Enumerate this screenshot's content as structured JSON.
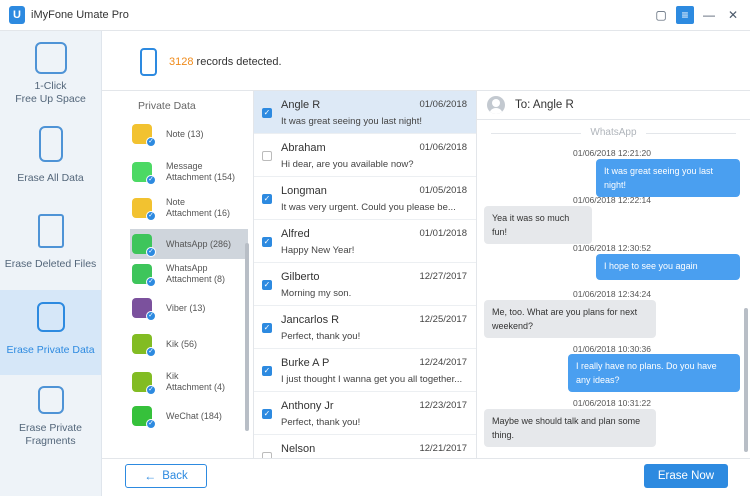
{
  "window": {
    "logo": "U",
    "title": "iMyFone Umate Pro",
    "controls": {
      "feedback_icon": "▢",
      "menu_icon": "≡",
      "minimize_icon": "—",
      "close_icon": "✕"
    }
  },
  "sidebar": {
    "items": [
      {
        "label": "1-Click\nFree Up Space",
        "icon": "broom-phone-icon",
        "active": false
      },
      {
        "label": "Erase All Data",
        "icon": "phone-erase-icon",
        "active": false
      },
      {
        "label": "Erase Deleted Files",
        "icon": "trash-icon",
        "active": false
      },
      {
        "label": "Erase Private Data",
        "icon": "lock-file-icon",
        "active": true
      },
      {
        "label": "Erase Private\nFragments",
        "icon": "app-fragment-icon",
        "active": false
      }
    ]
  },
  "header": {
    "count": "3128",
    "text": " records detected."
  },
  "private_data": {
    "title": "Private Data",
    "items": [
      {
        "label": "Note (13)",
        "icon": "note-icon",
        "color": "#f2c230"
      },
      {
        "label": "Message\nAttachment (154)",
        "icon": "message-icon",
        "color": "#4cd964"
      },
      {
        "label": "Note\nAttachment (16)",
        "icon": "note-icon",
        "color": "#f2c230"
      },
      {
        "label": "WhatsApp (286)",
        "icon": "whatsapp-icon",
        "color": "#3ec55b"
      },
      {
        "label": "WhatsApp\nAttachment (8)",
        "icon": "whatsapp-icon",
        "color": "#3ec55b"
      },
      {
        "label": "Viber (13)",
        "icon": "viber-icon",
        "color": "#7b519d"
      },
      {
        "label": "Kik (56)",
        "icon": "kik-icon",
        "color": "#82bc23"
      },
      {
        "label": "Kik\nAttachment (4)",
        "icon": "kik-icon",
        "color": "#82bc23"
      },
      {
        "label": "WeChat (184)",
        "icon": "wechat-icon",
        "color": "#36c13b"
      }
    ]
  },
  "contacts": [
    {
      "name": "Angle R",
      "date": "01/06/2018",
      "msg": "It was great seeing you last night!",
      "checked": true
    },
    {
      "name": "Abraham",
      "date": "01/06/2018",
      "msg": "Hi dear, are you available now?",
      "checked": false
    },
    {
      "name": "Longman",
      "date": "01/05/2018",
      "msg": "It was very urgent. Could you please be...",
      "checked": true
    },
    {
      "name": "Alfred",
      "date": "01/01/2018",
      "msg": "Happy New Year!",
      "checked": true
    },
    {
      "name": "Gilberto",
      "date": "12/27/2017",
      "msg": "Morning my son.",
      "checked": true
    },
    {
      "name": "Jancarlos R",
      "date": "12/25/2017",
      "msg": "Perfect, thank you!",
      "checked": true
    },
    {
      "name": "Burke A P",
      "date": "12/24/2017",
      "msg": "I just thought I wanna get you all together...",
      "checked": true
    },
    {
      "name": "Anthony Jr",
      "date": "12/23/2017",
      "msg": "Perfect, thank you!",
      "checked": true
    },
    {
      "name": "Nelson",
      "date": "12/21/2017",
      "msg": "",
      "checked": false
    }
  ],
  "chat": {
    "to_label": "To: Angle R",
    "app_label": "WhatsApp",
    "messages": [
      {
        "time": "01/06/2018 12:21:20",
        "text": "It was great seeing you last night!",
        "dir": "out"
      },
      {
        "time": "01/06/2018 12:22:14",
        "text": "Yea it was so much fun!",
        "dir": "in"
      },
      {
        "time": "01/06/2018 12:30:52",
        "text": "I hope to see you again",
        "dir": "out"
      },
      {
        "time": "01/06/2018 12:34:24",
        "text": "Me, too. What are you plans for next weekend?",
        "dir": "in"
      },
      {
        "time": "01/06/2018 10:30:36",
        "text": "I really have no plans. Do you have any ideas?",
        "dir": "out"
      },
      {
        "time": "01/06/2018 10:31:22",
        "text": "Maybe we should talk and plan some thing.",
        "dir": "in"
      }
    ]
  },
  "footer": {
    "back_label": "Back",
    "erase_label": "Erase Now"
  },
  "colors": {
    "accent": "#2d8ae0",
    "count": "#ef8a1a",
    "sidebar_bg": "#eef3f8"
  }
}
